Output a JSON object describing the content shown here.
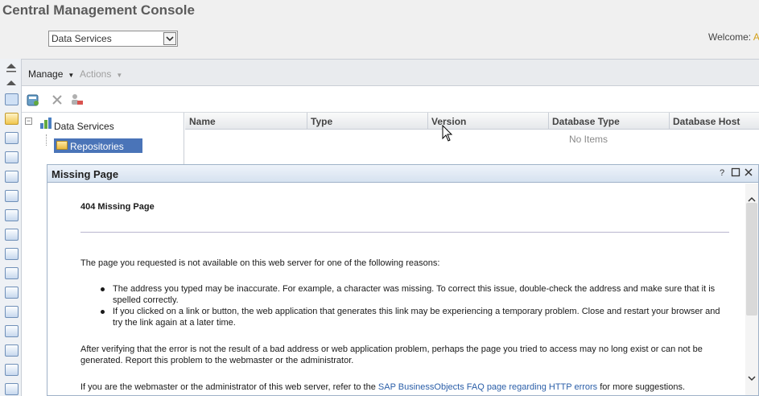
{
  "app": {
    "title": "Central Management Console",
    "selector_value": "Data Services",
    "welcome_label": "Welcome:",
    "welcome_user": "A"
  },
  "menubar": {
    "manage": "Manage",
    "actions": "Actions"
  },
  "tree": {
    "root": "Data Services",
    "selected": "Repositories"
  },
  "grid": {
    "columns": [
      "Name",
      "Type",
      "Version",
      "Database Type",
      "Database Host"
    ],
    "empty_text": "No Items"
  },
  "dialog": {
    "title": "Missing Page",
    "help": "?",
    "error_title": "404 Missing Page",
    "intro": "The page you requested is not available on this web server for one of the following reasons:",
    "reasons": [
      "The address you typed may be inaccurate. For example, a character was missing. To correct this issue, double-check the address and make sure that it is spelled correctly.",
      "If you clicked on a link or button, the web application that generates this link may be experiencing a temporary problem. Close and restart your browser and try the link again at a later time."
    ],
    "after": "After verifying that the error is not the result of a bad address or web application problem, perhaps the page you tried to access may no long exist or can not be generated. Report this problem to the webmaster or the administrator.",
    "admin_prefix": "If you are the webmaster or the administrator of this web server, refer to the",
    "admin_link": "SAP BusinessObjects FAQ page regarding HTTP errors",
    "admin_suffix": "for more suggestions."
  },
  "colors": {
    "selection": "#4a74b8",
    "link": "#2a5ea8",
    "dialog_border": "#9fb2c8"
  }
}
